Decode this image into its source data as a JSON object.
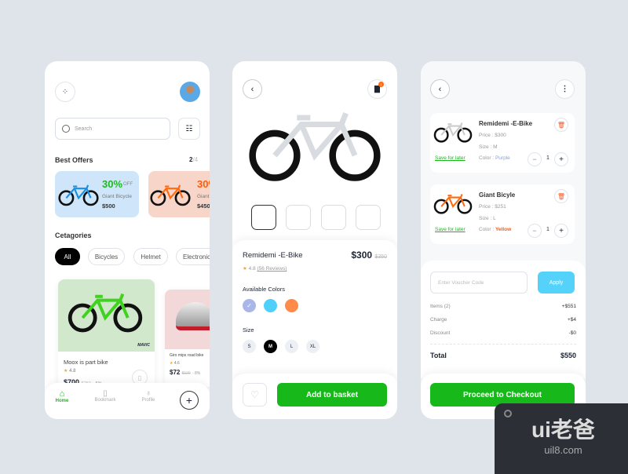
{
  "home": {
    "search_placeholder": "Search",
    "best_offers": "Best Offers",
    "page_current": "2",
    "page_total": "/4",
    "offers": [
      {
        "discount": "30%",
        "off": "OFF",
        "name": "Giant Bicycle",
        "price": "$500",
        "color": "#1fb81f",
        "bg": "#cfe6fa"
      },
      {
        "discount": "30%",
        "name": "Giant",
        "price": "$450",
        "color": "#ff5a0a",
        "bg": "#f7d6c9"
      }
    ],
    "categories_title": "Cetagories",
    "categories": [
      "All",
      "Bicycles",
      "Helmet",
      "Electronics"
    ],
    "products": [
      {
        "name": "Moox is part bike",
        "rating": "4.8",
        "price": "$700",
        "old_price": "$750",
        "discount": "- 5%",
        "brand": "MAVIC",
        "bg": "#d2e8cc"
      },
      {
        "name": "Giro mips road bike",
        "rating": "4.6",
        "price": "$72",
        "old_price": "$120",
        "discount": "- 8%",
        "bg": "#f3d8da"
      }
    ],
    "nav": [
      {
        "label": "Home",
        "icon": "home-icon"
      },
      {
        "label": "Bookmark",
        "icon": "bookmark-icon"
      },
      {
        "label": "Profile",
        "icon": "profile-icon"
      }
    ]
  },
  "detail": {
    "name": "Remidemi -E-Bike",
    "price": "$300",
    "old_price": "$350",
    "rating": "4.8",
    "reviews": "(56 Reviews)",
    "colors_title": "Available Colors",
    "colors": [
      "#a9b6ea",
      "#4fd0fa",
      "#ff8a4a"
    ],
    "size_title": "Size",
    "sizes": [
      "S",
      "M",
      "L",
      "XL"
    ],
    "selected_size": "M",
    "add_label": "Add to basket",
    "badge": "1"
  },
  "cart": {
    "items": [
      {
        "name": "Remidemi -E-Bike",
        "price": "$300",
        "size": "M",
        "color": "Purple",
        "color_hex": "#8aa2d8",
        "qty": "1",
        "save": "Save for later"
      },
      {
        "name": "Giant Bicyle",
        "price": "$251",
        "size": "L",
        "color": "Yellow",
        "color_hex": "#ff5a0a",
        "qty": "1",
        "save": "Save for later"
      }
    ],
    "price_label": "Price : ",
    "size_label": "Size : ",
    "color_label": "Color : ",
    "voucher_placeholder": "Enter Voucher Code",
    "apply": "Apply",
    "summary": [
      {
        "label": "Items (2)",
        "value": "+$551"
      },
      {
        "label": "Charge",
        "value": "+$4"
      },
      {
        "label": "Discount",
        "value": "-$0"
      }
    ],
    "total_label": "Total",
    "total": "$550",
    "checkout": "Proceed to Checkout"
  },
  "watermark": {
    "logo": "ui老爸",
    "url": "uil8.com"
  },
  "accent": "#17b91a"
}
